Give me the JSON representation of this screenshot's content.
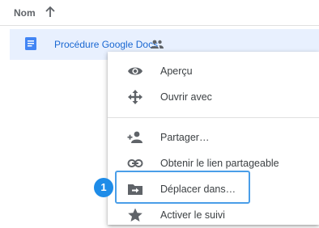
{
  "header": {
    "name_column_label": "Nom"
  },
  "file": {
    "name": "Procédure Google Docs"
  },
  "menu": {
    "items": [
      {
        "label": "Aperçu",
        "icon": "eye-icon"
      },
      {
        "label": "Ouvrir avec",
        "icon": "move-arrows-icon"
      },
      {
        "label": "Partager…",
        "icon": "add-person-icon"
      },
      {
        "label": "Obtenir le lien partageable",
        "icon": "link-icon"
      },
      {
        "label": "Déplacer dans…",
        "icon": "folder-move-icon"
      },
      {
        "label": "Activer le suivi",
        "icon": "star-icon"
      }
    ]
  },
  "annotation": {
    "step_number": "1"
  },
  "colors": {
    "link_blue": "#1967d2",
    "selected_row": "#e8f0fe",
    "highlight_border": "#4a9ee8",
    "badge_fill": "#1e8ce8",
    "icon_gray": "#5f6368",
    "doc_blue": "#4285f4"
  }
}
